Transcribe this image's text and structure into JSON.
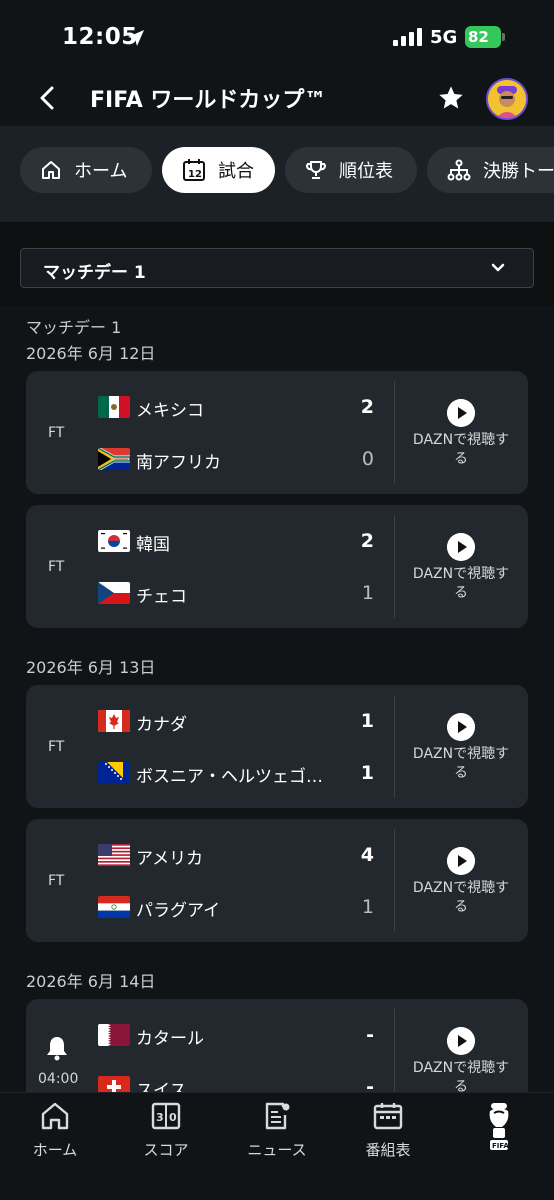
{
  "status_bar": {
    "time": "12:05",
    "network": "5G",
    "battery": "82"
  },
  "header": {
    "title": "FIFA ワールドカップ™"
  },
  "tabs": [
    {
      "label": "ホーム",
      "icon": "home-icon"
    },
    {
      "label": "試合",
      "icon": "calendar-icon",
      "active": true
    },
    {
      "label": "順位表",
      "icon": "trophy-icon"
    },
    {
      "label": "決勝トー",
      "icon": "bracket-icon"
    }
  ],
  "dropdown": {
    "label": "マッチデー 1"
  },
  "matchday_label": "マッチデー 1",
  "sections": [
    {
      "date": "2026年 6月 12日",
      "matches": [
        {
          "status": "FT",
          "home": "メキシコ",
          "home_score": "2",
          "away": "南アフリカ",
          "away_score": "0",
          "watch": "DAZNで視聴する",
          "home_flag": "mexico-flag",
          "away_flag": "south-africa-flag"
        },
        {
          "status": "FT",
          "home": "韓国",
          "home_score": "2",
          "away": "チェコ",
          "away_score": "1",
          "watch": "DAZNで視聴する",
          "home_flag": "korea-flag",
          "away_flag": "czech-flag"
        }
      ]
    },
    {
      "date": "2026年 6月 13日",
      "matches": [
        {
          "status": "FT",
          "home": "カナダ",
          "home_score": "1",
          "away": "ボスニア・ヘルツェゴ…",
          "away_score": "1",
          "watch": "DAZNで視聴する",
          "home_flag": "canada-flag",
          "away_flag": "bosnia-flag"
        },
        {
          "status": "FT",
          "home": "アメリカ",
          "home_score": "4",
          "away": "パラグアイ",
          "away_score": "1",
          "watch": "DAZNで視聴する",
          "home_flag": "usa-flag",
          "away_flag": "paraguay-flag"
        }
      ]
    },
    {
      "date": "2026年 6月 14日",
      "matches": [
        {
          "status": "04:00",
          "home": "カタール",
          "home_score": "-",
          "away": "スイス",
          "away_score": "-",
          "watch": "DAZNで視聴する",
          "home_flag": "qatar-flag",
          "away_flag": "swiss-flag"
        }
      ]
    }
  ],
  "bottom_nav": [
    {
      "label": "ホーム",
      "icon": "home-icon"
    },
    {
      "label": "スコア",
      "icon": "scoreboard-icon"
    },
    {
      "label": "ニュース",
      "icon": "news-icon"
    },
    {
      "label": "番組表",
      "icon": "calendar-icon"
    },
    {
      "label": "",
      "icon": "fifa-trophy-logo"
    }
  ],
  "colors": {
    "background": "#111417",
    "card": "#22282d",
    "tab_bar": "#1b2126",
    "battery": "#34c759"
  }
}
